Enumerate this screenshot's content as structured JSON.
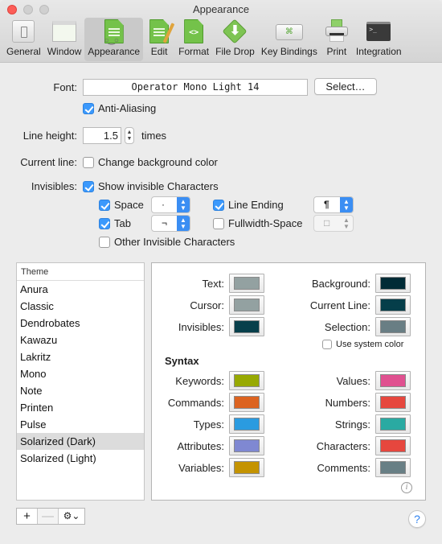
{
  "window": {
    "title": "Appearance"
  },
  "toolbar": {
    "items": [
      {
        "label": "General",
        "icon": "general-switch-icon"
      },
      {
        "label": "Window",
        "icon": "window-icon"
      },
      {
        "label": "Appearance",
        "icon": "document-glasses-icon",
        "active": true
      },
      {
        "label": "Edit",
        "icon": "document-pencil-icon"
      },
      {
        "label": "Format",
        "icon": "document-code-icon"
      },
      {
        "label": "File Drop",
        "icon": "download-arrow-icon"
      },
      {
        "label": "Key Bindings",
        "icon": "command-key-icon"
      },
      {
        "label": "Print",
        "icon": "printer-icon"
      },
      {
        "label": "Integration",
        "icon": "terminal-icon"
      }
    ],
    "glyphs": {
      "code": "<>",
      "glasses": "○‿○",
      "drop": "⬇",
      "key": "⌘",
      "term": ">_"
    }
  },
  "font": {
    "label": "Font:",
    "value": "Operator Mono Light 14",
    "select_button": "Select…",
    "anti_aliasing_label": "Anti-Aliasing",
    "anti_aliasing_checked": true
  },
  "line_height": {
    "label": "Line height:",
    "value": "1.5",
    "unit": "times",
    "stepper_up": "▲",
    "stepper_down": "▼"
  },
  "current_line": {
    "label": "Current line:",
    "option_label": "Change background color",
    "checked": false
  },
  "invisibles": {
    "label": "Invisibles:",
    "show_label": "Show invisible Characters",
    "show_checked": true,
    "space": {
      "label": "Space",
      "checked": true,
      "value": "·"
    },
    "tab": {
      "label": "Tab",
      "checked": true,
      "value": "¬"
    },
    "line_ending": {
      "label": "Line Ending",
      "checked": true,
      "value": "¶"
    },
    "fullwidth_space": {
      "label": "Fullwidth-Space",
      "checked": false,
      "value": "□"
    },
    "other_label": "Other Invisible Characters",
    "other_checked": false,
    "popup_arrows": "⌃⌄"
  },
  "themes": {
    "header": "Theme",
    "items": [
      "Anura",
      "Classic",
      "Dendrobates",
      "Kawazu",
      "Lakritz",
      "Mono",
      "Note",
      "Printen",
      "Pulse",
      "Solarized (Dark)",
      "Solarized (Light)"
    ],
    "selected": "Solarized (Dark)"
  },
  "colors": {
    "basic_left": [
      {
        "label": "Text:",
        "color": "#93a1a1"
      },
      {
        "label": "Cursor:",
        "color": "#93a1a1"
      },
      {
        "label": "Invisibles:",
        "color": "#073f4b"
      }
    ],
    "basic_right": [
      {
        "label": "Background:",
        "color": "#002b36"
      },
      {
        "label": "Current Line:",
        "color": "#053e4a"
      },
      {
        "label": "Selection:",
        "color": "#697e84"
      }
    ],
    "use_system_color_label": "Use system color",
    "use_system_color_checked": false,
    "syntax_header": "Syntax",
    "syntax_left": [
      {
        "label": "Keywords:",
        "color": "#97a902"
      },
      {
        "label": "Commands:",
        "color": "#dc6320"
      },
      {
        "label": "Types:",
        "color": "#2a9be0"
      },
      {
        "label": "Attributes:",
        "color": "#7f88d2"
      },
      {
        "label": "Variables:",
        "color": "#c49300"
      }
    ],
    "syntax_right": [
      {
        "label": "Values:",
        "color": "#e05190"
      },
      {
        "label": "Numbers:",
        "color": "#e6473e"
      },
      {
        "label": "Strings:",
        "color": "#2aaaa2"
      },
      {
        "label": "Characters:",
        "color": "#e6473e"
      },
      {
        "label": "Comments:",
        "color": "#687f85"
      }
    ],
    "info_glyph": "i"
  },
  "bottom": {
    "add": "+",
    "remove": "—",
    "gear": "⚙⌄",
    "help": "?"
  }
}
